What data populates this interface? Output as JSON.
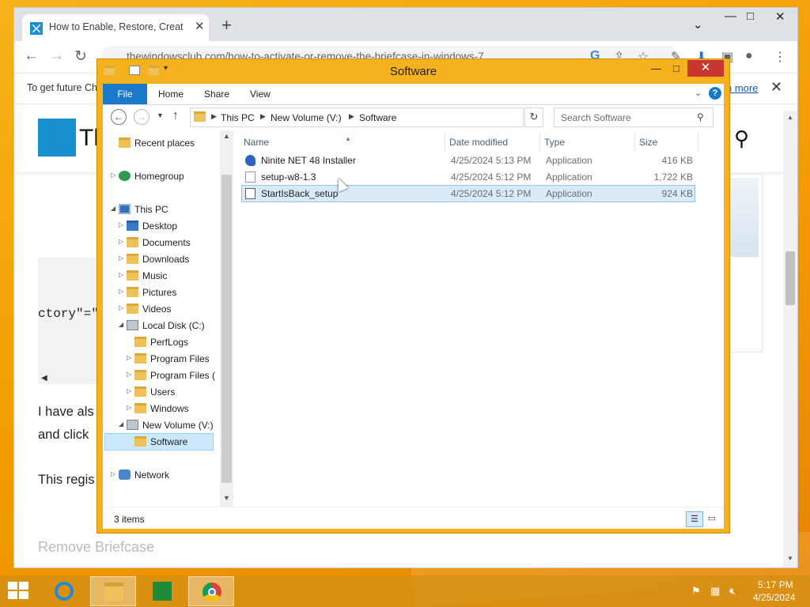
{
  "browser": {
    "tab_title": "How to Enable, Restore, Create B",
    "url": "thewindowsclub.com/how-to-activate-or-remove-the-briefcase-in-windows-7",
    "infobar_text": "To get future Ch",
    "infobar_link": "n more",
    "site_logo_text": "Th",
    "code_fragment": "ctory\"=\"",
    "article_lines": [
      "I have als",
      "and click",
      "This regis"
    ],
    "blurred_heading": "Remove Briefcase"
  },
  "explorer": {
    "title": "Software",
    "ribbon_tabs": [
      "File",
      "Home",
      "Share",
      "View"
    ],
    "breadcrumb": [
      "This PC",
      "New Volume (V:)",
      "Software"
    ],
    "search_placeholder": "Search Software",
    "nav_items": [
      {
        "label": "Recent places"
      },
      {
        "label": "Homegroup"
      },
      {
        "label": "This PC"
      },
      {
        "label": "Desktop"
      },
      {
        "label": "Documents"
      },
      {
        "label": "Downloads"
      },
      {
        "label": "Music"
      },
      {
        "label": "Pictures"
      },
      {
        "label": "Videos"
      },
      {
        "label": "Local Disk (C:)"
      },
      {
        "label": "PerfLogs"
      },
      {
        "label": "Program Files"
      },
      {
        "label": "Program Files ("
      },
      {
        "label": "Users"
      },
      {
        "label": "Windows"
      },
      {
        "label": "New Volume (V:)"
      },
      {
        "label": "Software"
      },
      {
        "label": "Network"
      }
    ],
    "columns": [
      "Name",
      "Date modified",
      "Type",
      "Size"
    ],
    "files": [
      {
        "name": "Ninite NET 48 Installer",
        "date": "4/25/2024 5:13 PM",
        "type": "Application",
        "size": "416 KB",
        "icon": "ninite-icon"
      },
      {
        "name": "setup-w8-1.3",
        "date": "4/25/2024 5:12 PM",
        "type": "Application",
        "size": "1,722 KB",
        "icon": "blank-file-icon"
      },
      {
        "name": "StartIsBack_setup",
        "date": "4/25/2024 5:12 PM",
        "type": "Application",
        "size": "924 KB",
        "icon": "setup-icon"
      }
    ],
    "status": "3 items"
  },
  "taskbar": {
    "time": "5:17 PM",
    "date": "4/25/2024"
  },
  "colors": {
    "explorer_frame": "#f5b21e",
    "selection": "#cce8ff",
    "file_tab": "#1979ca",
    "close_button": "#c7372f"
  }
}
